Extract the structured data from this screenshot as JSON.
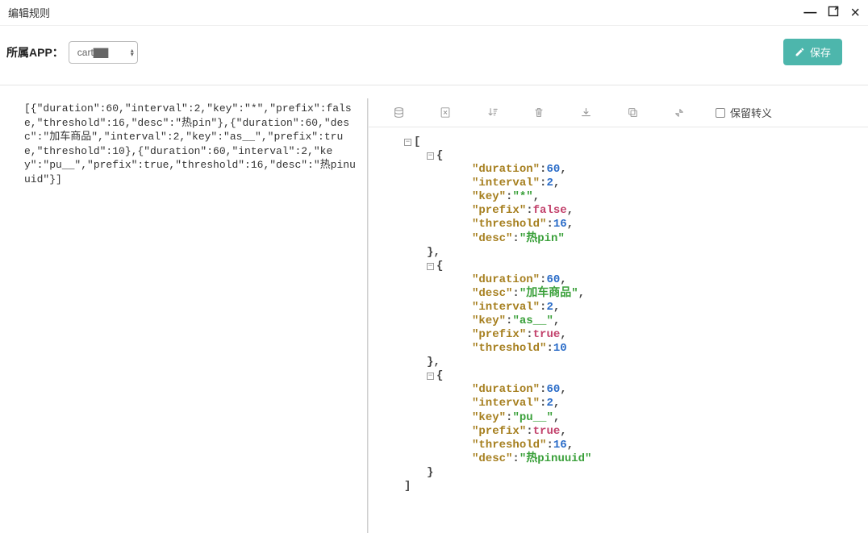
{
  "window": {
    "title": "编辑规则"
  },
  "header": {
    "app_label": "所属APP：",
    "app_selected": "cart▇▇",
    "save_label": "保存"
  },
  "toolbar": {
    "preserve_escape_label": "保留转义",
    "preserve_escape_checked": false
  },
  "raw_json_text": "[{\"duration\":60,\"interval\":2,\"key\":\"*\",\"prefix\":false,\"threshold\":16,\"desc\":\"热pin\"},{\"duration\":60,\"desc\":\"加车商品\",\"interval\":2,\"key\":\"as__\",\"prefix\":true,\"threshold\":10},{\"duration\":60,\"interval\":2,\"key\":\"pu__\",\"prefix\":true,\"threshold\":16,\"desc\":\"热pinuuid\"}]",
  "json_data": [
    {
      "duration": 60,
      "interval": 2,
      "key": "*",
      "prefix": false,
      "threshold": 16,
      "desc": "热pin"
    },
    {
      "duration": 60,
      "desc": "加车商品",
      "interval": 2,
      "key": "as__",
      "prefix": true,
      "threshold": 10
    },
    {
      "duration": 60,
      "interval": 2,
      "key": "pu__",
      "prefix": true,
      "threshold": 16,
      "desc": "热pinuuid"
    }
  ],
  "tokens": {
    "q": "\"",
    "colon": ":",
    "comma": ",",
    "lbrace": "{",
    "rbrace": "}",
    "lbracket": "[",
    "rbracket": "]",
    "t": "true",
    "f": "false",
    "minus": "−"
  },
  "keys": {
    "duration": "duration",
    "interval": "interval",
    "key": "key",
    "prefix": "prefix",
    "threshold": "threshold",
    "desc": "desc"
  }
}
